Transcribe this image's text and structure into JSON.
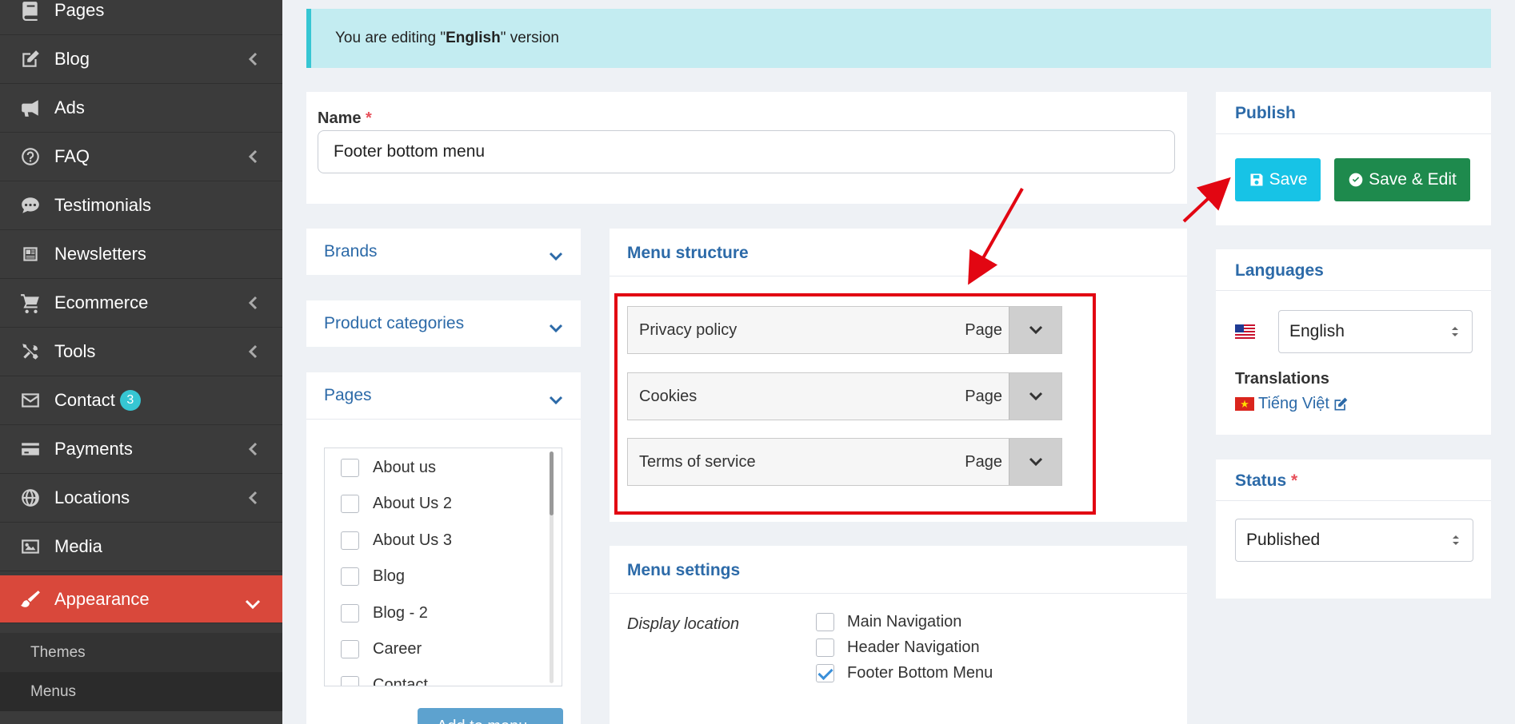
{
  "sidebar": {
    "items": [
      {
        "label": "Pages",
        "icon": "book-icon",
        "has_children": false
      },
      {
        "label": "Blog",
        "icon": "edit-icon",
        "has_children": true
      },
      {
        "label": "Ads",
        "icon": "bullhorn-icon",
        "has_children": false
      },
      {
        "label": "FAQ",
        "icon": "question-circle-icon",
        "has_children": true
      },
      {
        "label": "Testimonials",
        "icon": "comment-dots-icon",
        "has_children": false
      },
      {
        "label": "Newsletters",
        "icon": "newspaper-icon",
        "has_children": false
      },
      {
        "label": "Ecommerce",
        "icon": "shopping-cart-icon",
        "has_children": true
      },
      {
        "label": "Tools",
        "icon": "tools-icon",
        "has_children": true
      },
      {
        "label": "Contact",
        "icon": "envelope-icon",
        "has_children": false,
        "badge": "3"
      },
      {
        "label": "Payments",
        "icon": "credit-card-icon",
        "has_children": true
      },
      {
        "label": "Locations",
        "icon": "globe-icon",
        "has_children": true
      },
      {
        "label": "Media",
        "icon": "image-icon",
        "has_children": false
      },
      {
        "label": "Appearance",
        "icon": "paint-brush-icon",
        "has_children": true,
        "active": true
      }
    ],
    "sub_items": [
      {
        "label": "Themes"
      },
      {
        "label": "Menus",
        "current": true
      }
    ]
  },
  "alert": {
    "prefix": "You are editing \"",
    "language": "English",
    "suffix": "\" version"
  },
  "name_field": {
    "label": "Name",
    "required_mark": "*",
    "value": "Footer bottom menu"
  },
  "accordions": {
    "brands": "Brands",
    "product_categories": "Product categories",
    "pages": "Pages"
  },
  "pages_list": [
    "About us",
    "About Us 2",
    "About Us 3",
    "Blog",
    "Blog - 2",
    "Career",
    "Contact"
  ],
  "add_button_label": "Add to menu",
  "menu_structure": {
    "title": "Menu structure",
    "items": [
      {
        "label": "Privacy policy",
        "type": "Page"
      },
      {
        "label": "Cookies",
        "type": "Page"
      },
      {
        "label": "Terms of service",
        "type": "Page"
      }
    ]
  },
  "menu_settings": {
    "title": "Menu settings",
    "display_location_label": "Display location",
    "locations": [
      {
        "label": "Main Navigation",
        "checked": false
      },
      {
        "label": "Header Navigation",
        "checked": false
      },
      {
        "label": "Footer Bottom Menu",
        "checked": true
      }
    ]
  },
  "publish": {
    "title": "Publish",
    "save_label": "Save",
    "save_edit_label": "Save & Edit"
  },
  "languages": {
    "title": "Languages",
    "selected": "English",
    "translations_label": "Translations",
    "translation_link": "Tiếng Việt"
  },
  "status": {
    "title": "Status",
    "required_mark": "*",
    "selected": "Published"
  },
  "colors": {
    "sidebar_bg": "#3b3b3b",
    "active_bg": "#d9483b",
    "accent_blue": "#2c6aa8",
    "save_btn": "#17c3e6",
    "save_edit_btn": "#1e8a4d",
    "annotation_red": "#e20612"
  }
}
